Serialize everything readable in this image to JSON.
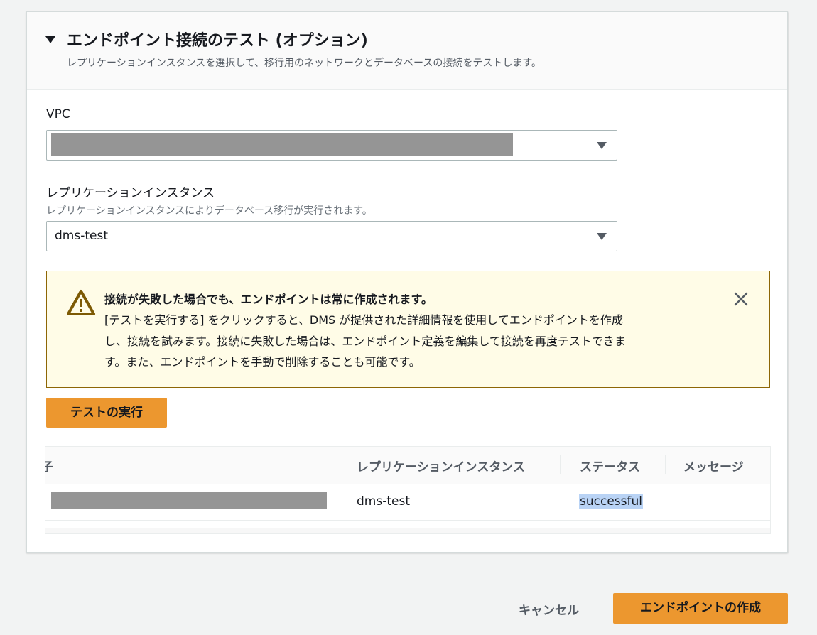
{
  "section": {
    "title": "エンドポイント接続のテスト (オプション)",
    "description": "レプリケーションインスタンスを選択して、移行用のネットワークとデータベースの接続をテストします。"
  },
  "vpc": {
    "label": "VPC",
    "value": ""
  },
  "replication_instance": {
    "label": "レプリケーションインスタンス",
    "description": "レプリケーションインスタンスによりデータベース移行が実行されます。",
    "value": "dms-test"
  },
  "warning": {
    "title": "接続が失敗した場合でも、エンドポイントは常に作成されます。",
    "lines": [
      "[テストを実行する] をクリックすると、DMS が提供された詳細情報を使用してエンドポイントを作成",
      "し、接続を試みます。接続に失敗した場合は、エンドポイント定義を編集して接続を再度テストできま",
      "す。また、エンドポイントを手動で削除することも可能です。"
    ],
    "color": "#8d6605"
  },
  "run_test_button": {
    "label": "テストの実行"
  },
  "results_table": {
    "columns": [
      "子",
      "レプリケーションインスタンス",
      "ステータス",
      "メッセージ"
    ],
    "rows": [
      {
        "identifier_prefix": "",
        "replication_instance": "dms-test",
        "status": "successful",
        "message": ""
      }
    ]
  },
  "footer": {
    "cancel_label": "キャンセル",
    "create_label": "エンドポイントの作成"
  },
  "colors": {
    "primary_button": "#ec972f",
    "warning_background": "#fffce7",
    "selection_highlight": "#b9d3f5"
  }
}
